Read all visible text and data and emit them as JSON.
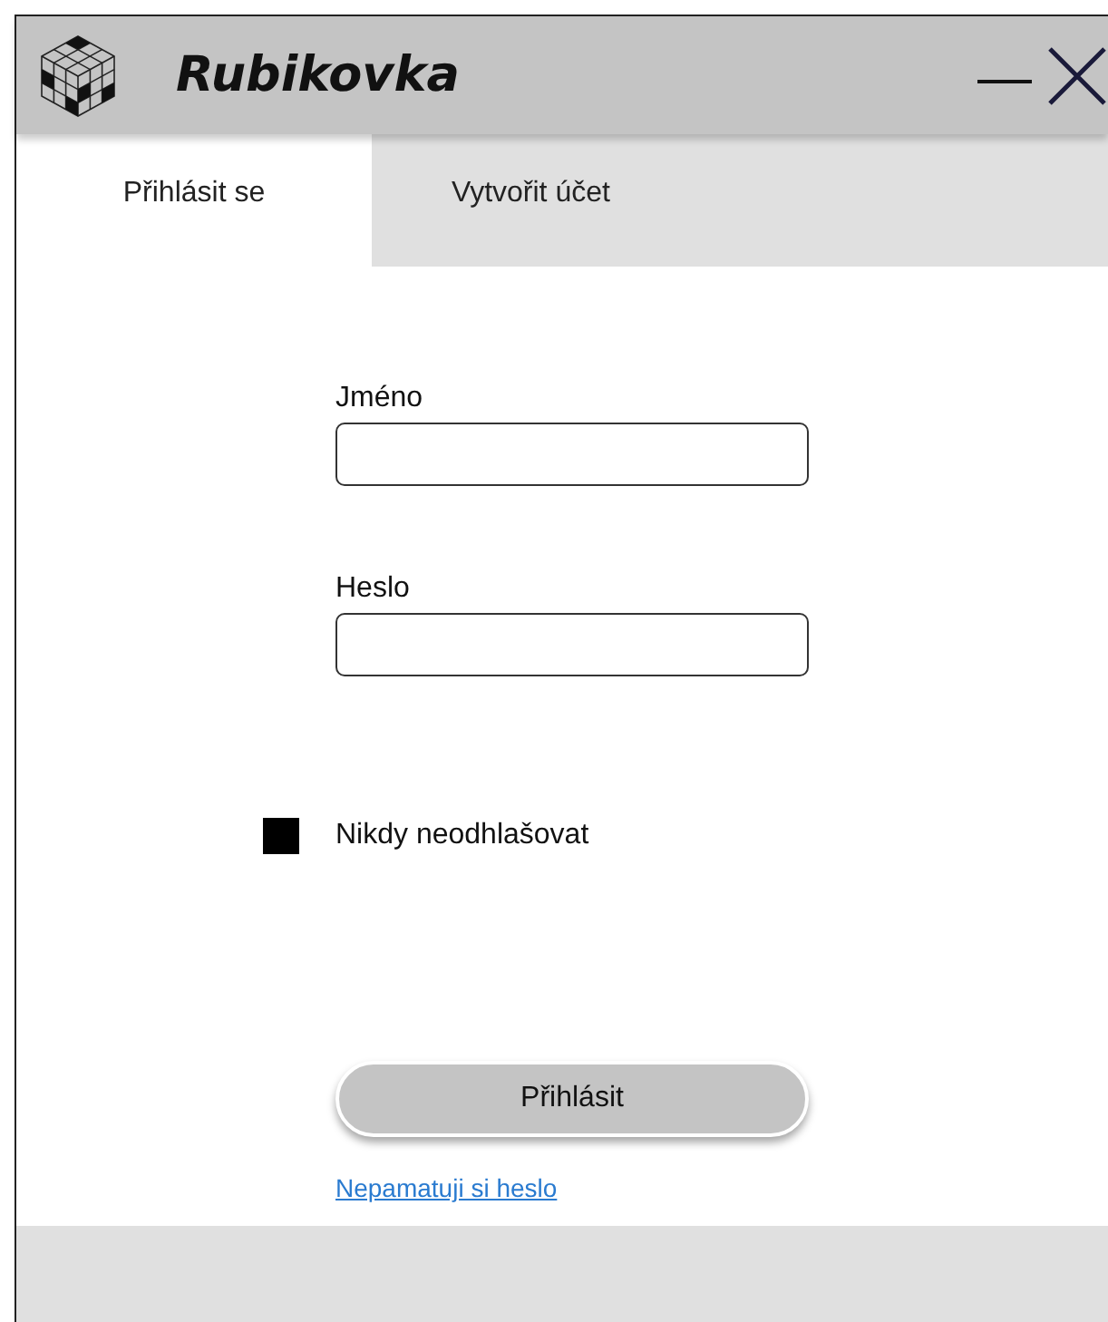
{
  "window": {
    "title": "Rubikovka"
  },
  "tabs": [
    {
      "label": "Přihlásit se",
      "selected": true
    },
    {
      "label": "Vytvořit účet",
      "selected": false
    }
  ],
  "fields": [
    {
      "label": "Jméno"
    },
    {
      "label": "Heslo"
    }
  ],
  "remember": {
    "label": "Nikdy neodhlašovat",
    "checked": true
  },
  "login_button": "Přihlásit",
  "forgot_link": "Nepamatuji si heslo"
}
